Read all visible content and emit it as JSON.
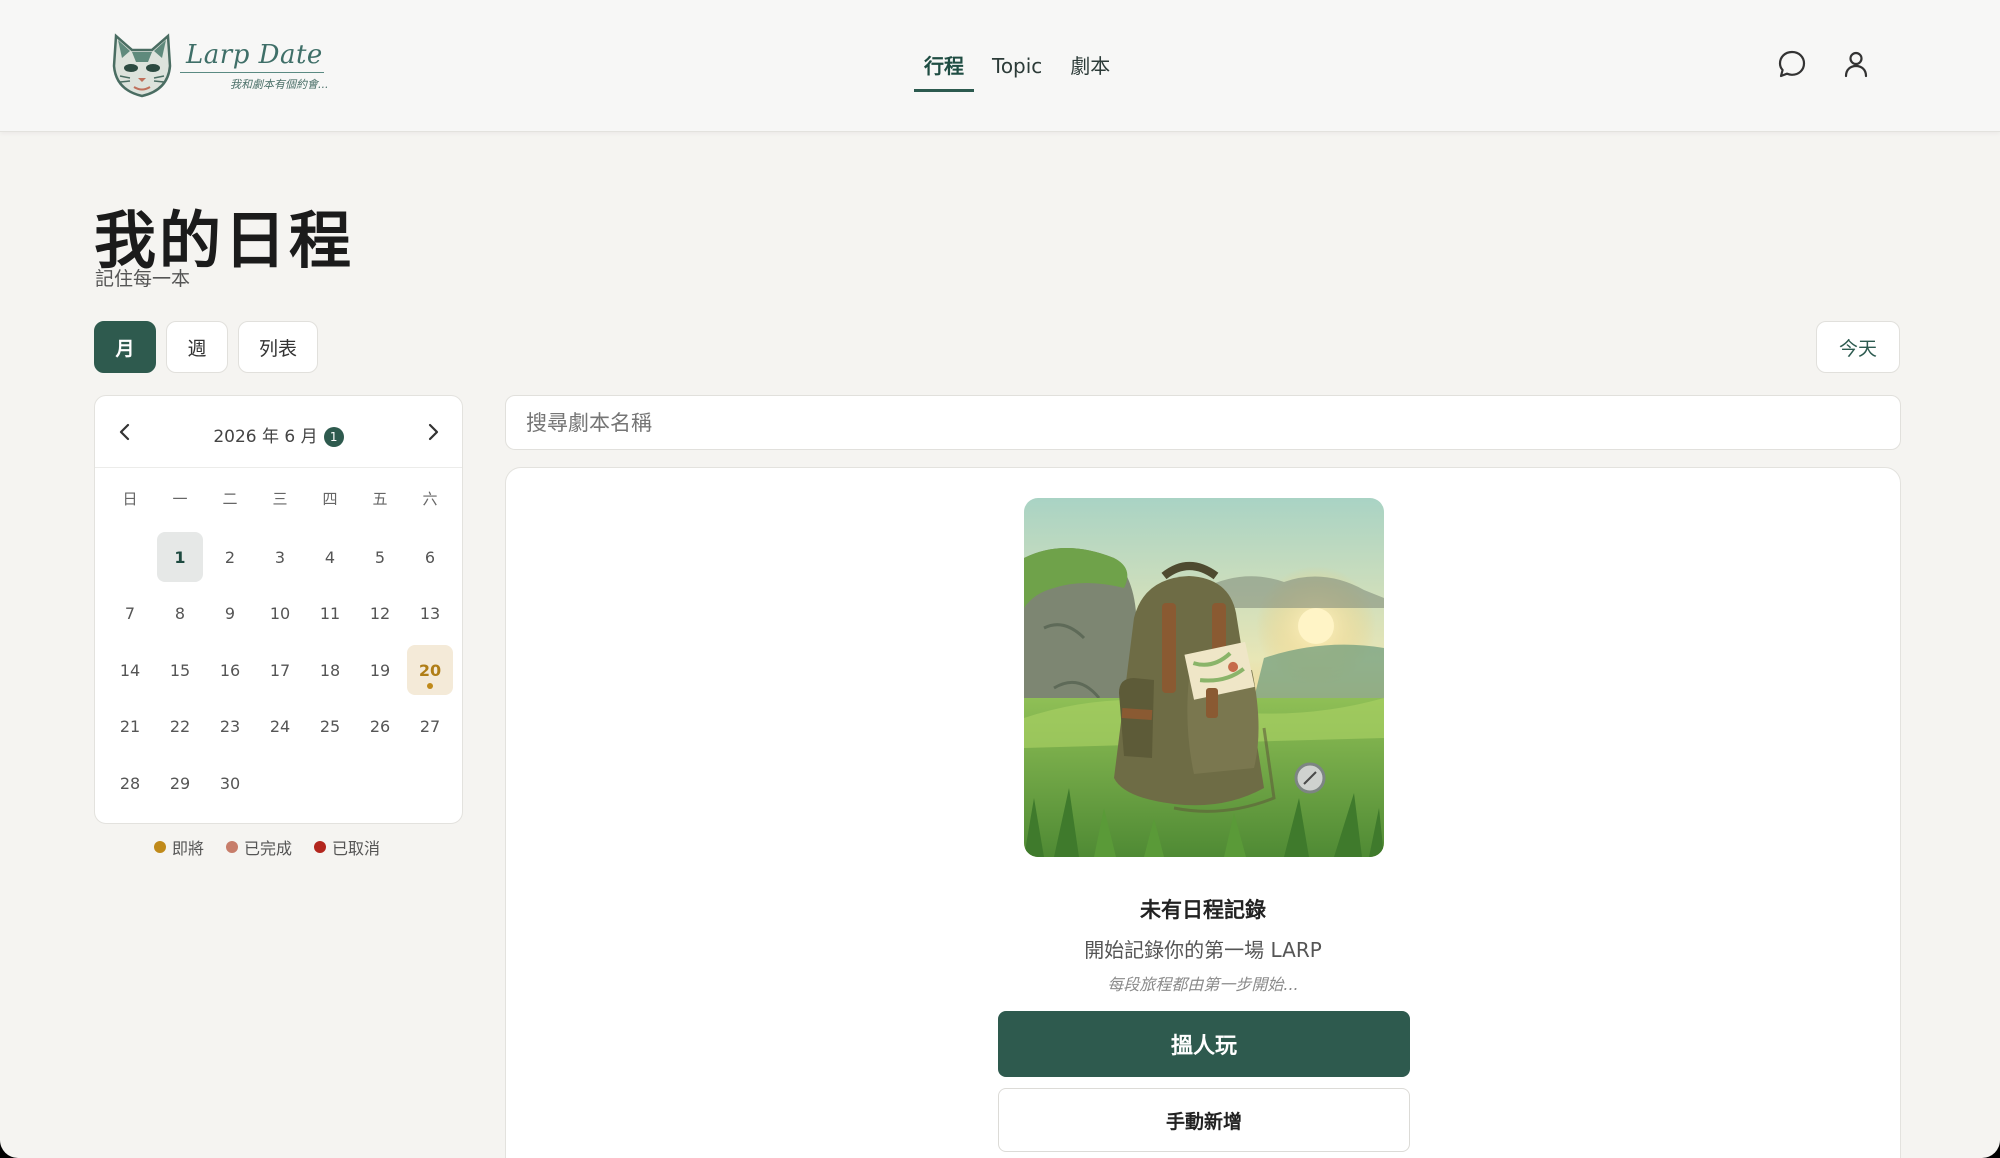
{
  "brand": {
    "name": "Larp Date",
    "tagline": "我和劇本有個約會..."
  },
  "nav": {
    "items": [
      {
        "label": "行程",
        "active": true
      },
      {
        "label": "Topic",
        "active": false
      },
      {
        "label": "劇本",
        "active": false
      }
    ]
  },
  "header_icons": [
    "chat-icon",
    "user-icon"
  ],
  "page": {
    "title": "我的日程",
    "subtitle": "記住每一本"
  },
  "view_tabs": [
    {
      "label": "月",
      "active": true
    },
    {
      "label": "週",
      "active": false
    },
    {
      "label": "列表",
      "active": false
    }
  ],
  "today_label": "今天",
  "calendar": {
    "month_label": "2026 年 6 月",
    "badge_count": "1",
    "weekdays": [
      "日",
      "一",
      "二",
      "三",
      "四",
      "五",
      "六"
    ],
    "weeks": [
      [
        "",
        "1",
        "2",
        "3",
        "4",
        "5",
        "6"
      ],
      [
        "7",
        "8",
        "9",
        "10",
        "11",
        "12",
        "13"
      ],
      [
        "14",
        "15",
        "16",
        "17",
        "18",
        "19",
        "20"
      ],
      [
        "21",
        "22",
        "23",
        "24",
        "25",
        "26",
        "27"
      ],
      [
        "28",
        "29",
        "30",
        "",
        "",
        "",
        ""
      ]
    ],
    "selected_day": "1",
    "today_day": "20",
    "event_days": [
      "20"
    ]
  },
  "legend": [
    {
      "label": "即將",
      "color": "#c08a1a"
    },
    {
      "label": "已完成",
      "color": "#c77d6a"
    },
    {
      "label": "已取消",
      "color": "#b3261e"
    }
  ],
  "search": {
    "placeholder": "搜尋劇本名稱"
  },
  "empty_state": {
    "title": "未有日程記錄",
    "description": "開始記錄你的第一場 LARP",
    "hint": "每段旅程都由第一步開始...",
    "primary_button": "搵人玩",
    "secondary_button": "手動新增"
  },
  "colors": {
    "accent": "#2e5a4e",
    "today_bg": "#f4ead8",
    "today_text": "#b07e17"
  }
}
